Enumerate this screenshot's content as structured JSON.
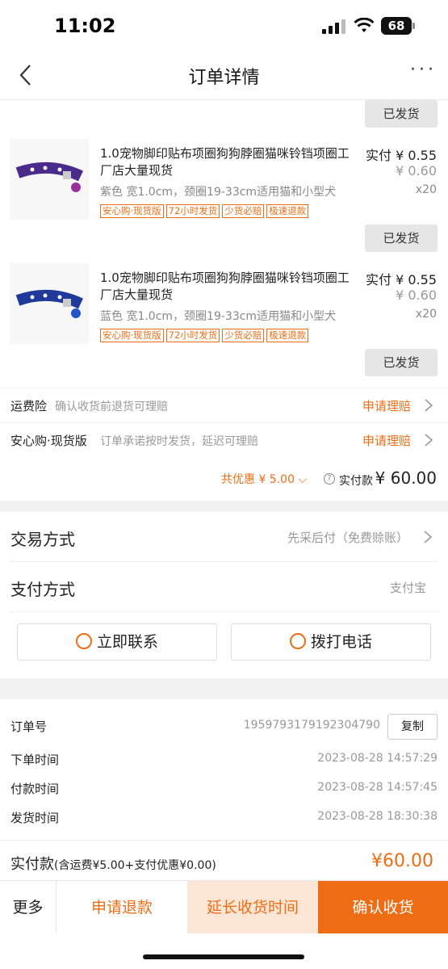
{
  "status": {
    "time": "11:02",
    "battery": "68"
  },
  "nav": {
    "title": "订单详情",
    "more": "···"
  },
  "shipped_label": "已发货",
  "products": [
    {
      "name": "1.0宠物脚印贴布项圈狗狗脖圈猫咪铃铛项圈工厂店大量现货",
      "price": "实付 ¥ 0.55",
      "original_price": "¥ 0.60",
      "spec": "紫色 宽1.0cm，颈圈19-33cm适用猫和小型犬",
      "qty": "x20",
      "collar_color": "#4a2a8a",
      "tags": [
        "安心购·现货版",
        "72小时发货",
        "少货必赔",
        "极速退款"
      ]
    },
    {
      "name": "1.0宠物脚印贴布项圈狗狗脖圈猫咪铃铛项圈工厂店大量现货",
      "price": "实付 ¥ 0.55",
      "original_price": "¥ 0.60",
      "spec": "蓝色 宽1.0cm，颈圈19-33cm适用猫和小型犬",
      "qty": "x20",
      "collar_color": "#1f3a9a",
      "tags": [
        "安心购·现货版",
        "72小时发货",
        "少货必赔",
        "极速退款"
      ]
    }
  ],
  "services": [
    {
      "name": "运费险",
      "desc": "确认收货前退货可理赔",
      "action": "申请理赔"
    },
    {
      "name": "安心购·现货版",
      "desc": "订单承诺按时发货，延迟可理赔",
      "action": "申请理赔"
    }
  ],
  "summary": {
    "discount": "共优惠 ¥ 5.00",
    "paid_label": "实付款",
    "paid_amount": "¥ 60.00"
  },
  "trade": {
    "label": "交易方式",
    "value": "先采后付（免费赊账）"
  },
  "payment": {
    "label": "支付方式",
    "value": "支付宝"
  },
  "contact": {
    "chat": "立即联系",
    "call": "拨打电话"
  },
  "order_info": [
    {
      "label": "订单号",
      "value": "1959793179192304790"
    },
    {
      "label": "下单时间",
      "value": "2023-08-28 14:57:29"
    },
    {
      "label": "付款时间",
      "value": "2023-08-28 14:57:45"
    },
    {
      "label": "发货时间",
      "value": "2023-08-28 18:30:38"
    }
  ],
  "copy_label": "复制",
  "total": {
    "label": "实付款",
    "detail": "(含运费¥5.00+支付优惠¥0.00)",
    "amount": "¥60.00"
  },
  "bottom": {
    "more": "更多",
    "refund": "申请退款",
    "extend": "延长收货时间",
    "confirm": "确认收货"
  },
  "colors": {
    "accent": "#ee6d14",
    "extend_bg": "#fde6d6",
    "confirm_bg": "#ee6d14"
  }
}
